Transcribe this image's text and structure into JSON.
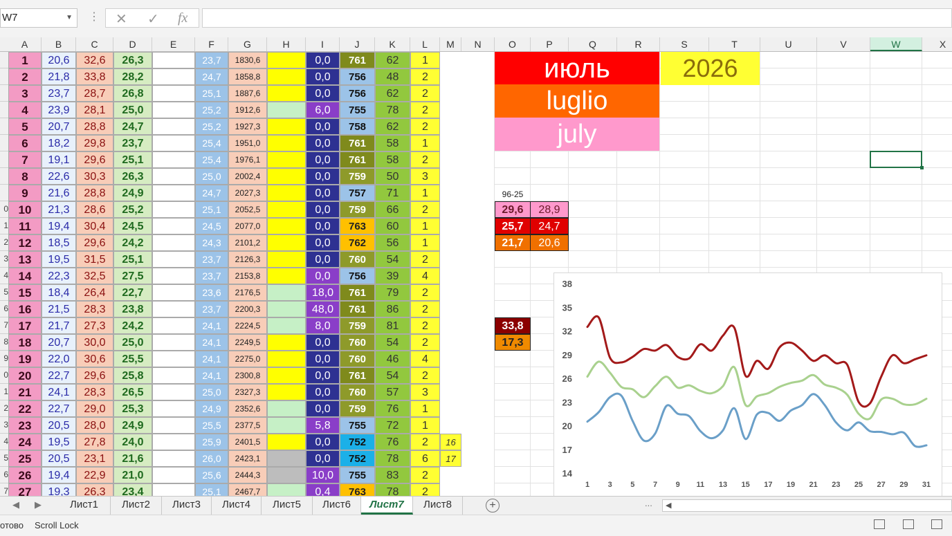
{
  "toolbar": {
    "name_box": "W7",
    "cancel_icon": "✕",
    "enter_icon": "✓",
    "fx_label": "fx",
    "formula_value": ""
  },
  "columns": [
    {
      "key": "A",
      "label": "A"
    },
    {
      "key": "B",
      "label": "B"
    },
    {
      "key": "C",
      "label": "C"
    },
    {
      "key": "D",
      "label": "D"
    },
    {
      "key": "E",
      "label": "E"
    },
    {
      "key": "F",
      "label": "F"
    },
    {
      "key": "G",
      "label": "G"
    },
    {
      "key": "H",
      "label": "H"
    },
    {
      "key": "I",
      "label": "I"
    },
    {
      "key": "J",
      "label": "J"
    },
    {
      "key": "K",
      "label": "K"
    },
    {
      "key": "L",
      "label": "L"
    },
    {
      "key": "M",
      "label": "M"
    },
    {
      "key": "N",
      "label": "N"
    },
    {
      "key": "O",
      "label": "O"
    },
    {
      "key": "P",
      "label": "P"
    },
    {
      "key": "Q",
      "label": "Q"
    },
    {
      "key": "R",
      "label": "R"
    },
    {
      "key": "S",
      "label": "S"
    },
    {
      "key": "T",
      "label": "T"
    },
    {
      "key": "U",
      "label": "U"
    },
    {
      "key": "V",
      "label": "V"
    },
    {
      "key": "W",
      "label": "W"
    },
    {
      "key": "X",
      "label": "X"
    }
  ],
  "selected_column": "W",
  "row_headers": [
    "",
    "",
    "",
    "",
    "",
    "",
    "",
    "",
    "",
    "0",
    "1",
    "2",
    "3",
    "4",
    "5",
    "6",
    "7",
    "8",
    "9",
    "0",
    "1",
    "2",
    "3",
    "4",
    "5",
    "6",
    "7"
  ],
  "rows": [
    {
      "A": "1",
      "B": "20,6",
      "C": "32,6",
      "D": "26,3",
      "F": "23,7",
      "G": "1830,6",
      "H": "y",
      "I": "0,0",
      "J": "761",
      "K": "62",
      "L": "1",
      "M": ""
    },
    {
      "A": "2",
      "B": "21,8",
      "C": "33,8",
      "D": "28,2",
      "F": "24,7",
      "G": "1858,8",
      "H": "y",
      "I": "0,0",
      "J": "756",
      "K": "48",
      "L": "2",
      "M": ""
    },
    {
      "A": "3",
      "B": "23,7",
      "C": "28,7",
      "D": "26,8",
      "F": "25,1",
      "G": "1887,6",
      "H": "y",
      "I": "0,0",
      "J": "756",
      "K": "62",
      "L": "2",
      "M": ""
    },
    {
      "A": "4",
      "B": "23,9",
      "C": "28,1",
      "D": "25,0",
      "F": "25,2",
      "G": "1912,6",
      "H": "g",
      "I": "6,0",
      "J": "755",
      "K": "78",
      "L": "2",
      "M": ""
    },
    {
      "A": "5",
      "B": "20,7",
      "C": "28,8",
      "D": "24,7",
      "F": "25,2",
      "G": "1927,3",
      "H": "y",
      "I": "0,0",
      "J": "758",
      "K": "62",
      "L": "2",
      "M": ""
    },
    {
      "A": "6",
      "B": "18,2",
      "C": "29,8",
      "D": "23,7",
      "F": "25,4",
      "G": "1951,0",
      "H": "y",
      "I": "0,0",
      "J": "761",
      "K": "58",
      "L": "1",
      "M": ""
    },
    {
      "A": "7",
      "B": "19,1",
      "C": "29,6",
      "D": "25,1",
      "F": "25,4",
      "G": "1976,1",
      "H": "y",
      "I": "0,0",
      "J": "761",
      "K": "58",
      "L": "2",
      "M": ""
    },
    {
      "A": "8",
      "B": "22,6",
      "C": "30,3",
      "D": "26,3",
      "F": "25,0",
      "G": "2002,4",
      "H": "y",
      "I": "0,0",
      "J": "759",
      "K": "50",
      "L": "3",
      "M": ""
    },
    {
      "A": "9",
      "B": "21,6",
      "C": "28,8",
      "D": "24,9",
      "F": "24,7",
      "G": "2027,3",
      "H": "y",
      "I": "0,0",
      "J": "757",
      "K": "71",
      "L": "1",
      "M": ""
    },
    {
      "A": "10",
      "B": "21,3",
      "C": "28,6",
      "D": "25,2",
      "F": "25,1",
      "G": "2052,5",
      "H": "y",
      "I": "0,0",
      "J": "759",
      "K": "66",
      "L": "2",
      "M": ""
    },
    {
      "A": "11",
      "B": "19,4",
      "C": "30,4",
      "D": "24,5",
      "F": "24,5",
      "G": "2077,0",
      "H": "y",
      "I": "0,0",
      "J": "763",
      "K": "60",
      "L": "1",
      "M": ""
    },
    {
      "A": "12",
      "B": "18,5",
      "C": "29,6",
      "D": "24,2",
      "F": "24,3",
      "G": "2101,2",
      "H": "y",
      "I": "0,0",
      "J": "762",
      "K": "56",
      "L": "1",
      "M": ""
    },
    {
      "A": "13",
      "B": "19,5",
      "C": "31,5",
      "D": "25,1",
      "F": "23,7",
      "G": "2126,3",
      "H": "y",
      "I": "0,0",
      "J": "760",
      "K": "54",
      "L": "2",
      "M": ""
    },
    {
      "A": "14",
      "B": "22,3",
      "C": "32,5",
      "D": "27,5",
      "F": "23,7",
      "G": "2153,8",
      "H": "y",
      "I": "0,0",
      "J": "756",
      "K": "39",
      "L": "4",
      "M": ""
    },
    {
      "A": "15",
      "B": "18,4",
      "C": "26,4",
      "D": "22,7",
      "F": "23,6",
      "G": "2176,5",
      "H": "g",
      "I": "18,0",
      "J": "761",
      "K": "79",
      "L": "2",
      "M": ""
    },
    {
      "A": "16",
      "B": "21,5",
      "C": "28,3",
      "D": "23,8",
      "F": "23,7",
      "G": "2200,3",
      "H": "g",
      "I": "48,0",
      "J": "761",
      "K": "86",
      "L": "2",
      "M": ""
    },
    {
      "A": "17",
      "B": "21,7",
      "C": "27,3",
      "D": "24,2",
      "F": "24,1",
      "G": "2224,5",
      "H": "g",
      "I": "8,0",
      "J": "759",
      "K": "81",
      "L": "2",
      "M": ""
    },
    {
      "A": "18",
      "B": "20,7",
      "C": "30,0",
      "D": "25,0",
      "F": "24,1",
      "G": "2249,5",
      "H": "y",
      "I": "0,0",
      "J": "760",
      "K": "54",
      "L": "2",
      "M": ""
    },
    {
      "A": "19",
      "B": "22,0",
      "C": "30,6",
      "D": "25,5",
      "F": "24,1",
      "G": "2275,0",
      "H": "y",
      "I": "0,0",
      "J": "760",
      "K": "46",
      "L": "4",
      "M": ""
    },
    {
      "A": "20",
      "B": "22,7",
      "C": "29,6",
      "D": "25,8",
      "F": "24,1",
      "G": "2300,8",
      "H": "y",
      "I": "0,0",
      "J": "761",
      "K": "54",
      "L": "2",
      "M": ""
    },
    {
      "A": "21",
      "B": "24,1",
      "C": "28,3",
      "D": "26,5",
      "F": "25,0",
      "G": "2327,3",
      "H": "y",
      "I": "0,0",
      "J": "760",
      "K": "57",
      "L": "3",
      "M": ""
    },
    {
      "A": "22",
      "B": "22,7",
      "C": "29,0",
      "D": "25,3",
      "F": "24,9",
      "G": "2352,6",
      "H": "g",
      "I": "0,0",
      "J": "759",
      "K": "76",
      "L": "1",
      "M": ""
    },
    {
      "A": "23",
      "B": "20,5",
      "C": "28,0",
      "D": "24,9",
      "F": "25,5",
      "G": "2377,5",
      "H": "g",
      "I": "5,8",
      "J": "755",
      "K": "72",
      "L": "1",
      "M": ""
    },
    {
      "A": "24",
      "B": "19,5",
      "C": "27,8",
      "D": "24,0",
      "F": "25,9",
      "G": "2401,5",
      "H": "y",
      "I": "0,0",
      "J": "752",
      "K": "76",
      "L": "2",
      "M": "16"
    },
    {
      "A": "25",
      "B": "20,5",
      "C": "23,1",
      "D": "21,6",
      "F": "26,0",
      "G": "2423,1",
      "H": "x",
      "I": "0,0",
      "J": "752",
      "K": "78",
      "L": "6",
      "M": "17"
    },
    {
      "A": "26",
      "B": "19,4",
      "C": "22,9",
      "D": "21,0",
      "F": "25,6",
      "G": "2444,3",
      "H": "x",
      "I": "10,0",
      "J": "755",
      "K": "83",
      "L": "2",
      "M": ""
    },
    {
      "A": "27",
      "B": "19,3",
      "C": "26,3",
      "D": "23,4",
      "F": "25,1",
      "G": "2467,7",
      "H": "g",
      "I": "0,4",
      "J": "763",
      "K": "78",
      "L": "2",
      "M": ""
    }
  ],
  "titles": {
    "ru": "июль",
    "it": "luglio",
    "en": "july",
    "year": "2026"
  },
  "climate": {
    "label": "96-25",
    "rows": [
      {
        "o": "29,6",
        "p": "28,9"
      },
      {
        "o": "25,7",
        "p": "24,7"
      },
      {
        "o": "21,7",
        "p": "20,6"
      }
    ],
    "extremes": {
      "max": "33,8",
      "min": "17,3"
    }
  },
  "colors": {
    "red_title": "#ff0000",
    "orange_title": "#ff6600",
    "pink_title": "#ff99cc",
    "year_bg": "#ffff33",
    "series_max": "#a31a1a",
    "series_mean": "#a9d18e",
    "series_min": "#6a9fc8"
  },
  "chart_data": {
    "type": "line",
    "x": [
      1,
      2,
      3,
      4,
      5,
      6,
      7,
      8,
      9,
      10,
      11,
      12,
      13,
      14,
      15,
      16,
      17,
      18,
      19,
      20,
      21,
      22,
      23,
      24,
      25,
      26,
      27,
      28,
      29,
      30,
      31
    ],
    "x_tick_labels": [
      "1",
      "3",
      "5",
      "7",
      "9",
      "11",
      "13",
      "15",
      "17",
      "19",
      "21",
      "23",
      "25",
      "27",
      "29",
      "31"
    ],
    "ylim": [
      14,
      38
    ],
    "y_ticks": [
      14,
      17,
      20,
      23,
      26,
      29,
      32,
      35,
      38
    ],
    "grid": false,
    "legend": "none",
    "series": [
      {
        "values": [
          32.6,
          33.8,
          28.7,
          28.1,
          28.8,
          29.8,
          29.6,
          30.3,
          28.8,
          28.6,
          30.4,
          29.6,
          31.5,
          32.5,
          26.4,
          28.3,
          27.3,
          30.0,
          30.6,
          29.6,
          28.3,
          29.0,
          28.0,
          27.8,
          23.1,
          22.9,
          26.3,
          29.0,
          28.0,
          28.5,
          29.0
        ]
      },
      {
        "values": [
          26.3,
          28.2,
          26.8,
          25.0,
          24.7,
          23.7,
          25.1,
          26.3,
          24.9,
          25.2,
          24.5,
          24.2,
          25.1,
          27.5,
          22.7,
          23.8,
          24.2,
          25.0,
          25.5,
          25.8,
          26.5,
          25.3,
          24.9,
          24.0,
          21.6,
          21.0,
          23.4,
          23.5,
          22.8,
          22.8,
          23.5
        ]
      },
      {
        "values": [
          20.6,
          21.8,
          23.7,
          23.9,
          20.7,
          18.2,
          19.1,
          22.6,
          21.6,
          21.3,
          19.4,
          18.5,
          19.5,
          22.3,
          18.4,
          21.5,
          21.7,
          20.7,
          22.0,
          22.7,
          24.1,
          22.7,
          20.5,
          19.5,
          20.5,
          19.4,
          19.3,
          19.0,
          19.2,
          17.5,
          17.6
        ]
      }
    ]
  },
  "sheet_tabs": [
    "Лист1",
    "Лист2",
    "Лист3",
    "Лист4",
    "Лист5",
    "Лист6",
    "Лист7",
    "Лист8"
  ],
  "active_tab": "Лист7",
  "tab_nav": {
    "prev": "◀",
    "next": "▶",
    "more": "...",
    "add": "+"
  },
  "status": {
    "ready": "отово",
    "scroll_lock": "Scroll Lock"
  }
}
